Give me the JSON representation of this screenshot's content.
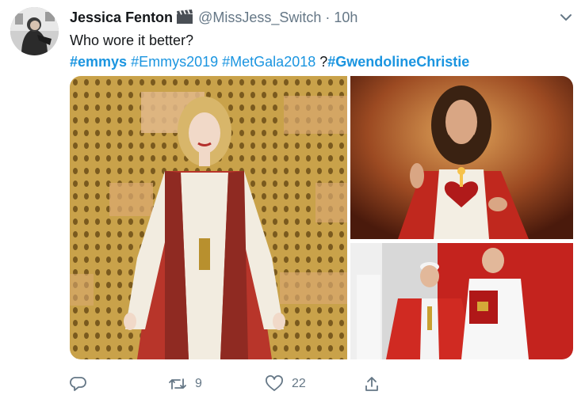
{
  "tweet": {
    "author_name": "Jessica Fenton",
    "handle": "@MissJess_Switch",
    "separator": "·",
    "time": "10h",
    "text_line1": "Who wore it better?",
    "hashtags": [
      "#emmys",
      "#Emmys2019",
      "#MetGala2018"
    ],
    "question_mark": "?",
    "last_hashtag": "#GwendolineChristie"
  },
  "actions": {
    "reply_count": "",
    "retweet_count": "9",
    "like_count": "22"
  },
  "colors": {
    "link": "#1b95e0",
    "secondary_text": "#657786"
  },
  "icons": [
    "clapperboard-icon",
    "chevron-down-icon",
    "reply-icon",
    "retweet-icon",
    "like-icon",
    "share-icon"
  ]
}
